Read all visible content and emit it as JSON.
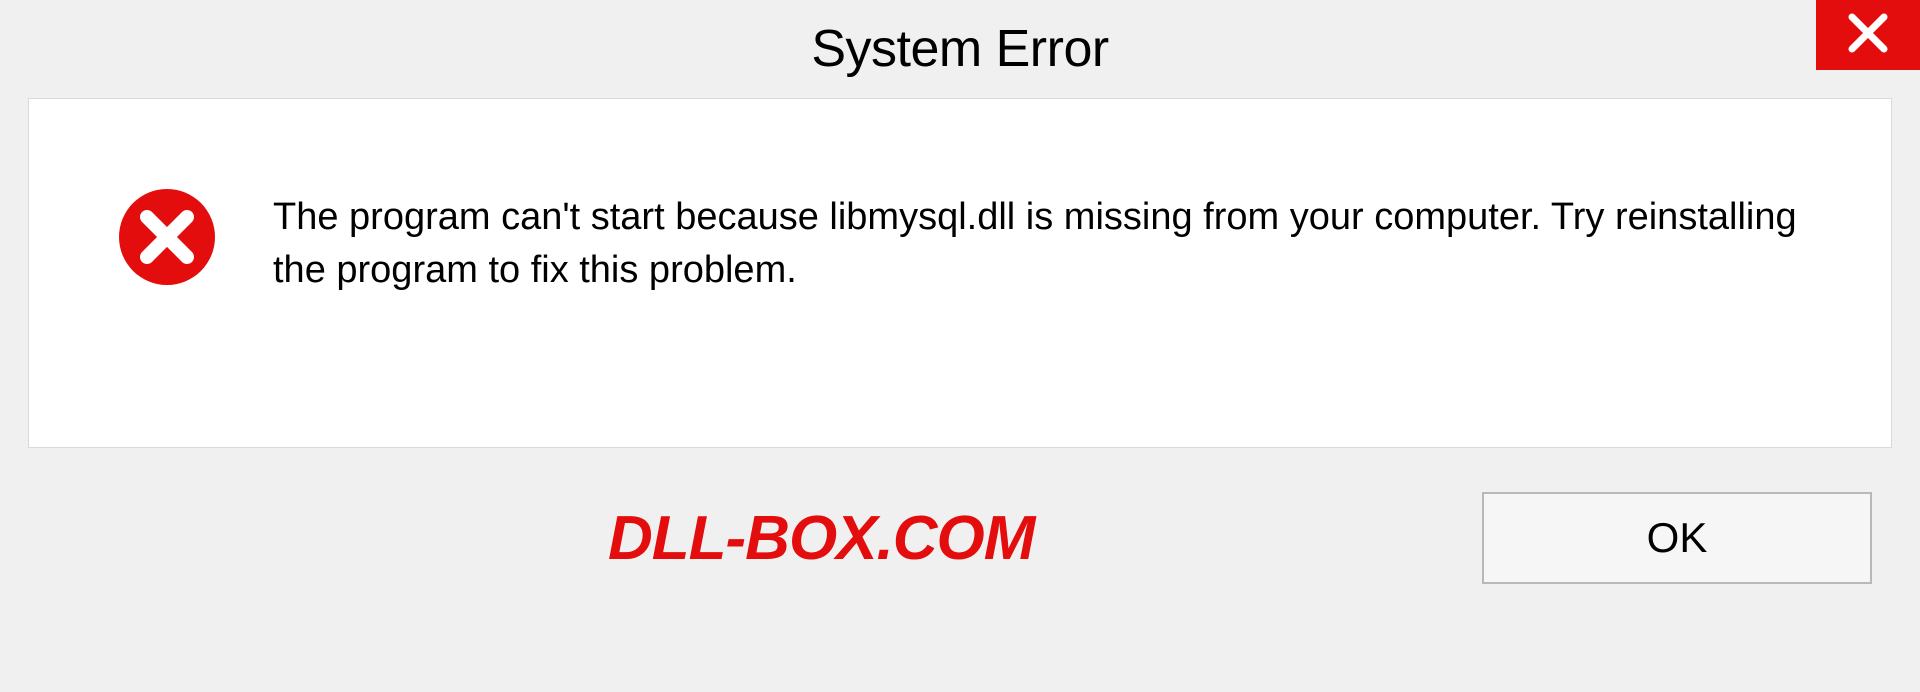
{
  "dialog": {
    "title": "System Error",
    "message": "The program can't start because libmysql.dll is missing from your computer. Try reinstalling the program to fix this problem.",
    "ok_label": "OK"
  },
  "watermark": "DLL-BOX.COM",
  "colors": {
    "accent_red": "#e30d0d",
    "panel_bg": "#ffffff",
    "page_bg": "#f0f0f0"
  }
}
